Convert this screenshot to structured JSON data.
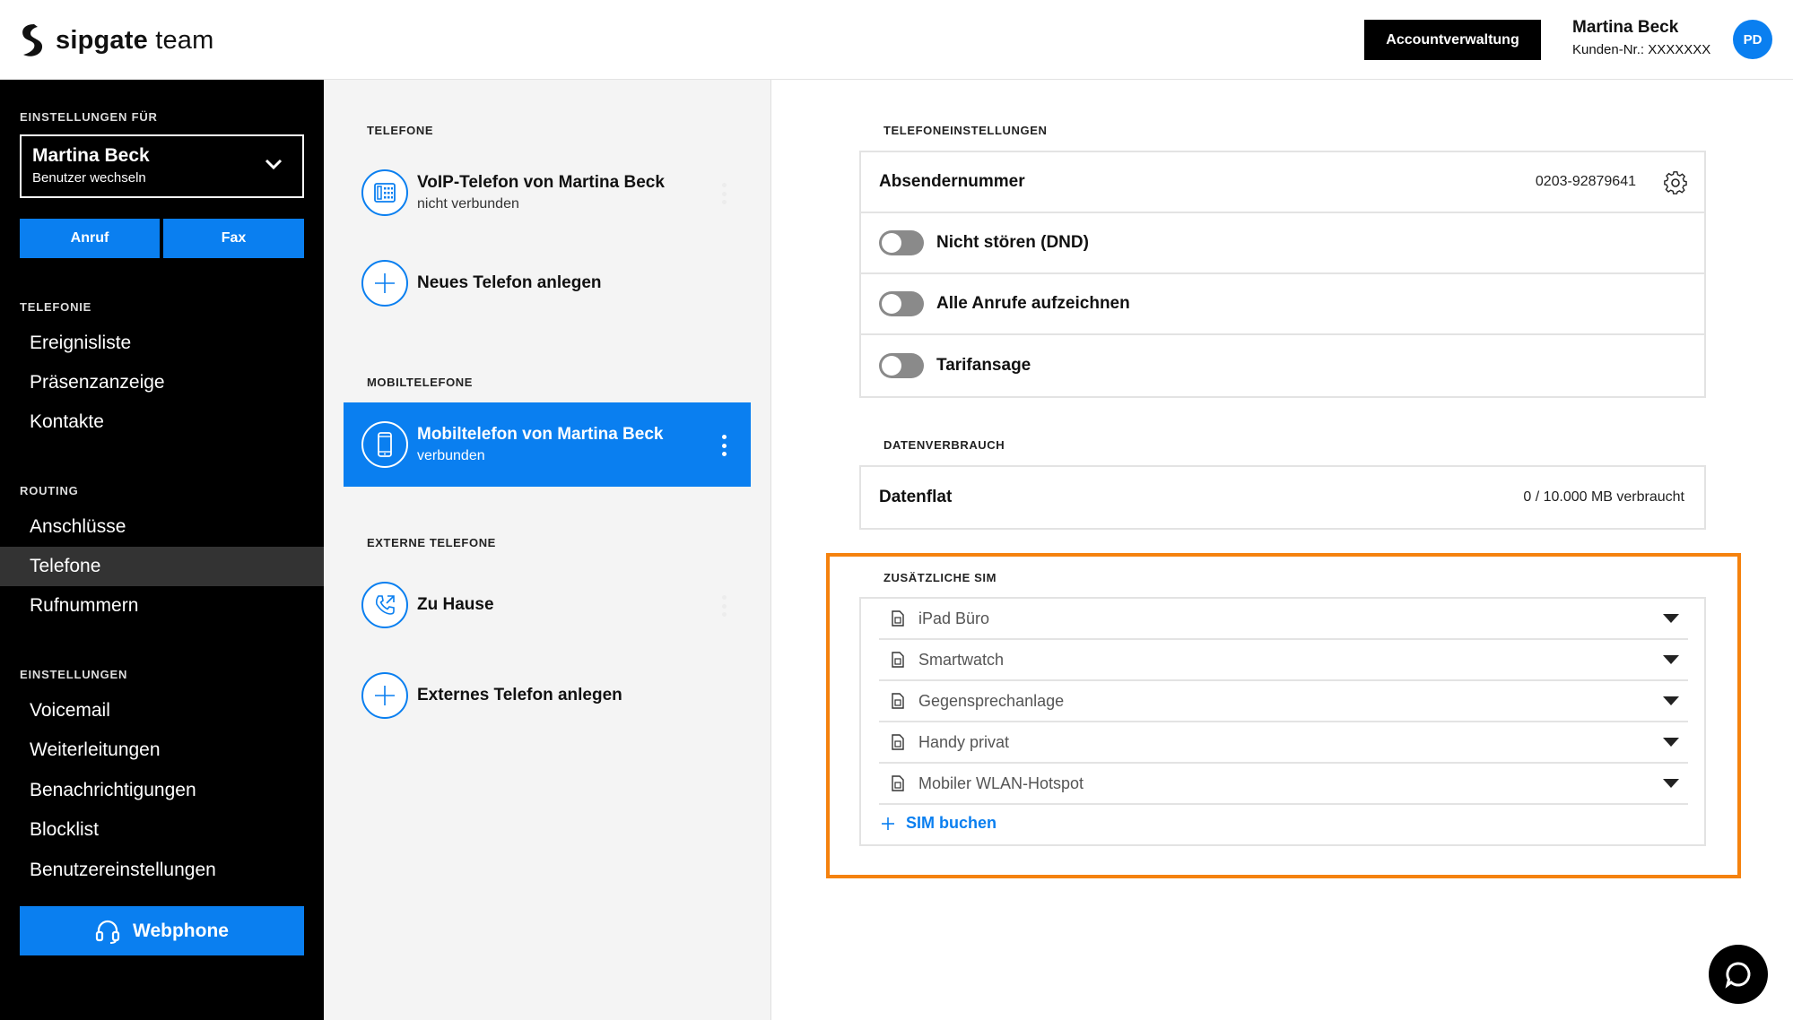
{
  "header": {
    "brand_bold": "sipgate",
    "brand_light": "team",
    "account_button": "Accountverwaltung",
    "user_name": "Martina Beck",
    "customer_number": "Kunden-Nr.: XXXXXXX",
    "avatar_initials": "PD"
  },
  "sidebar": {
    "settings_for_label": "EINSTELLUNGEN FÜR",
    "current_user": "Martina Beck",
    "switch_user": "Benutzer wechseln",
    "call_button": "Anruf",
    "fax_button": "Fax",
    "sections": [
      {
        "title": "TELEFONIE",
        "items": [
          "Ereignisliste",
          "Präsenzanzeige",
          "Kontakte"
        ]
      },
      {
        "title": "ROUTING",
        "items": [
          "Anschlüsse",
          "Telefone",
          "Rufnummern"
        ]
      },
      {
        "title": "EINSTELLUNGEN",
        "items": [
          "Voicemail",
          "Weiterleitungen",
          "Benachrichtigungen",
          "Blocklist",
          "Benutzereinstellungen"
        ]
      }
    ],
    "active_item": "Telefone",
    "webphone_button": "Webphone"
  },
  "middle": {
    "telefone_title": "TELEFONE",
    "voip_title": "VoIP-Telefon von Martina Beck",
    "voip_status": "nicht verbunden",
    "new_phone": "Neues Telefon anlegen",
    "mobile_title_section": "MOBILTELEFONE",
    "mobile_title": "Mobiltelefon von Martina Beck",
    "mobile_status": "verbunden",
    "external_section": "EXTERNE TELEFONE",
    "home_title": "Zu Hause",
    "new_external": "Externes Telefon anlegen"
  },
  "settings": {
    "section_title": "TELEFONEINSTELLUNGEN",
    "sender_label": "Absendernummer",
    "sender_value": "0203-92879641",
    "dnd_label": "Nicht stören (DND)",
    "dnd_on": false,
    "record_label": "Alle Anrufe aufzeichnen",
    "record_on": false,
    "tariff_label": "Tarifansage",
    "tariff_on": false
  },
  "data_usage": {
    "section_title": "DATENVERBRAUCH",
    "label": "Datenflat",
    "value": "0 / 10.000 MB verbraucht"
  },
  "extra_sim": {
    "section_title": "ZUSÄTZLICHE SIM",
    "items": [
      "iPad Büro",
      "Smartwatch",
      "Gegensprechanlage",
      "Handy privat",
      "Mobiler WLAN-Hotspot"
    ],
    "add_label": "SIM buchen"
  },
  "colors": {
    "accent": "#0a7ff0",
    "highlight": "#f5820e",
    "sidebar_bg": "#000000"
  }
}
